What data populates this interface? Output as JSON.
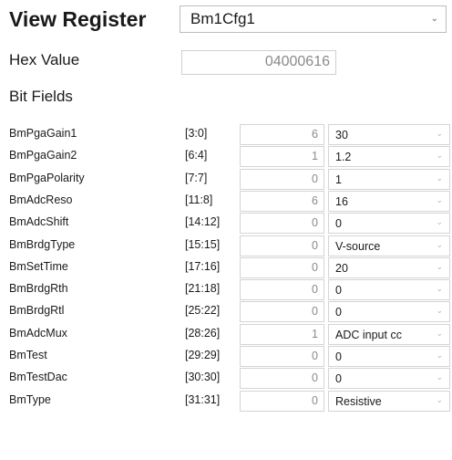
{
  "header": {
    "title": "View Register",
    "selected_register": "Bm1Cfg1",
    "dropdown_icon": "chevron-down-icon"
  },
  "hex": {
    "label": "Hex Value",
    "value": "04000616"
  },
  "bit_fields": {
    "label": "Bit Fields",
    "rows": [
      {
        "name": "BmPgaGain1",
        "range": "[3:0]",
        "value": "6",
        "option": "30"
      },
      {
        "name": "BmPgaGain2",
        "range": "[6:4]",
        "value": "1",
        "option": "1.2"
      },
      {
        "name": "BmPgaPolarity",
        "range": "[7:7]",
        "value": "0",
        "option": "1"
      },
      {
        "name": "BmAdcReso",
        "range": "[11:8]",
        "value": "6",
        "option": "16"
      },
      {
        "name": "BmAdcShift",
        "range": "[14:12]",
        "value": "0",
        "option": "0"
      },
      {
        "name": "BmBrdgType",
        "range": "[15:15]",
        "value": "0",
        "option": "V-source"
      },
      {
        "name": "BmSetTime",
        "range": "[17:16]",
        "value": "0",
        "option": "20"
      },
      {
        "name": "BmBrdgRth",
        "range": "[21:18]",
        "value": "0",
        "option": "0"
      },
      {
        "name": "BmBrdgRtl",
        "range": "[25:22]",
        "value": "0",
        "option": "0"
      },
      {
        "name": "BmAdcMux",
        "range": "[28:26]",
        "value": "1",
        "option": "ADC input cc"
      },
      {
        "name": "BmTest",
        "range": "[29:29]",
        "value": "0",
        "option": "0"
      },
      {
        "name": "BmTestDac",
        "range": "[30:30]",
        "value": "0",
        "option": "0"
      },
      {
        "name": "BmType",
        "range": "[31:31]",
        "value": "0",
        "option": "Resistive"
      }
    ]
  }
}
